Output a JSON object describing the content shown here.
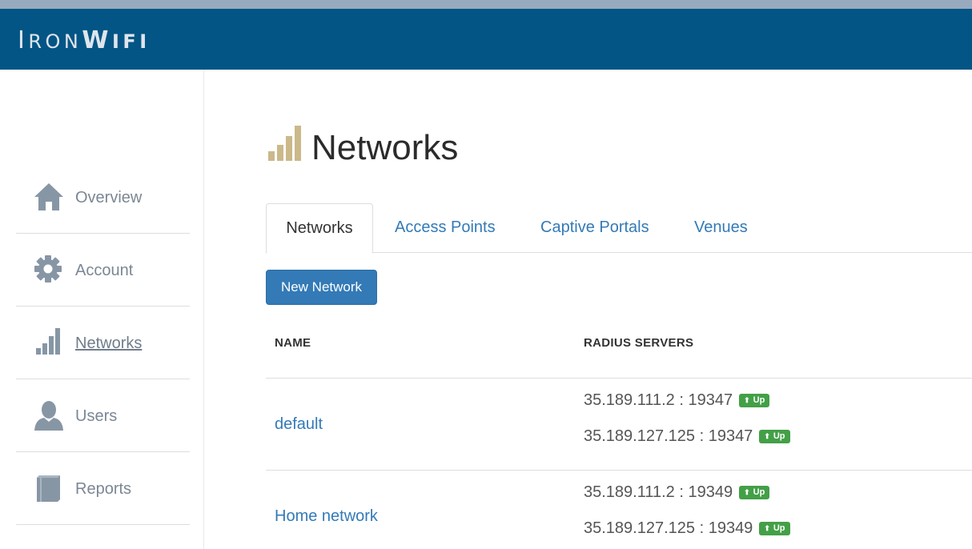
{
  "brand": {
    "logo_prefix_cap": "I",
    "logo_prefix": "RON",
    "logo_suffix_cap": "W",
    "logo_suffix": "IFI"
  },
  "sidebar": {
    "items": [
      {
        "label": "Overview",
        "icon": "home-icon"
      },
      {
        "label": "Account",
        "icon": "gear-icon"
      },
      {
        "label": "Networks",
        "icon": "signal-bars-icon",
        "active": true
      },
      {
        "label": "Users",
        "icon": "user-icon"
      },
      {
        "label": "Reports",
        "icon": "book-icon"
      }
    ]
  },
  "page": {
    "title": "Networks",
    "title_icon": "signal-bars-icon"
  },
  "tabs": [
    {
      "label": "Networks",
      "active": true
    },
    {
      "label": "Access Points"
    },
    {
      "label": "Captive Portals"
    },
    {
      "label": "Venues"
    }
  ],
  "toolbar": {
    "new_network_label": "New Network"
  },
  "table": {
    "columns": [
      "NAME",
      "RADIUS SERVERS"
    ],
    "rows": [
      {
        "name": "default",
        "servers": [
          {
            "address": "35.189.111.2 : 19347",
            "status": "Up"
          },
          {
            "address": "35.189.127.125 : 19347",
            "status": "Up"
          }
        ]
      },
      {
        "name": "Home network",
        "servers": [
          {
            "address": "35.189.111.2 : 19349",
            "status": "Up"
          },
          {
            "address": "35.189.127.125 : 19349",
            "status": "Up"
          }
        ]
      }
    ]
  },
  "colors": {
    "header": "#025585",
    "accent": "#337ab7",
    "status_up": "#43a047",
    "title_icon": "#cbb98a",
    "sidebar_icon": "#8796a5"
  }
}
